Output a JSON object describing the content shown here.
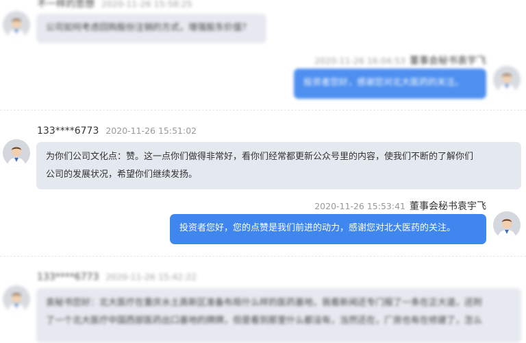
{
  "messages": [
    {
      "id": 1,
      "blurred": true,
      "question": {
        "user": "不一样的思想",
        "time": "2020-11-26 15:58:25",
        "text": "公司如何考虑回购股份注销的方式，增强股东价值？"
      },
      "answer": {
        "user": "董事会秘书袁宇飞",
        "time": "2020-11-26 16:04:53",
        "text": "投资者您好，感谢您对北大医药的关注。"
      }
    },
    {
      "id": 2,
      "blurred": false,
      "question": {
        "user": "133****6773",
        "time": "2020-11-26 15:51:02",
        "text_line1": "为你们公司文化点：赞。这一点你们做得非常好，看你们经常都更新公众号里的内容，使我们不断的了解你们",
        "text_line2": "公司的发展状况，希望你们继续发扬。"
      },
      "answer": {
        "user": "董事会秘书袁宇飞",
        "time": "2020-11-26 15:53:41",
        "text": "投资者您好，您的点赞是我们前进的动力，感谢您对北大医药的关注。"
      }
    },
    {
      "id": 3,
      "blurred": true,
      "question": {
        "user": "133****6773",
        "time": "2020-11-26 15:42:22",
        "text_line1": "袁秘书您好：北大医疗在重庆水土高新区准备布局什么样的医药基地，我看新闻还专门报了一条在正大道，还附",
        "text_line2": "了一个北大医疗中国西部医药出口基地的牌牌，但是看到那里什么都没有，当然还在，厂房也有在修建了，怎么"
      }
    }
  ],
  "icons": {
    "avatar": "user-avatar-icon"
  },
  "colors": {
    "accent": "#3f86ee",
    "bubble_left": "#e4e8ef"
  }
}
